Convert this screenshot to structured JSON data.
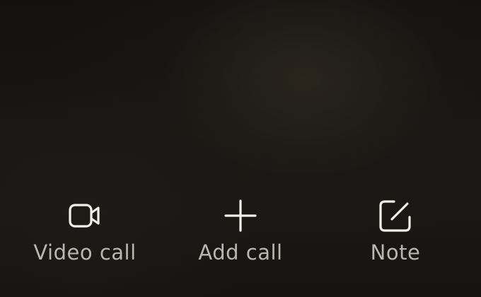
{
  "actions": {
    "video_call": {
      "label": "Video call",
      "icon": "video-camera-icon"
    },
    "add_call": {
      "label": "Add call",
      "icon": "plus-icon"
    },
    "note": {
      "label": "Note",
      "icon": "edit-note-icon"
    }
  },
  "colors": {
    "background": "#141311",
    "icon": "#f2f0ea",
    "label": "#b9b6ad"
  }
}
